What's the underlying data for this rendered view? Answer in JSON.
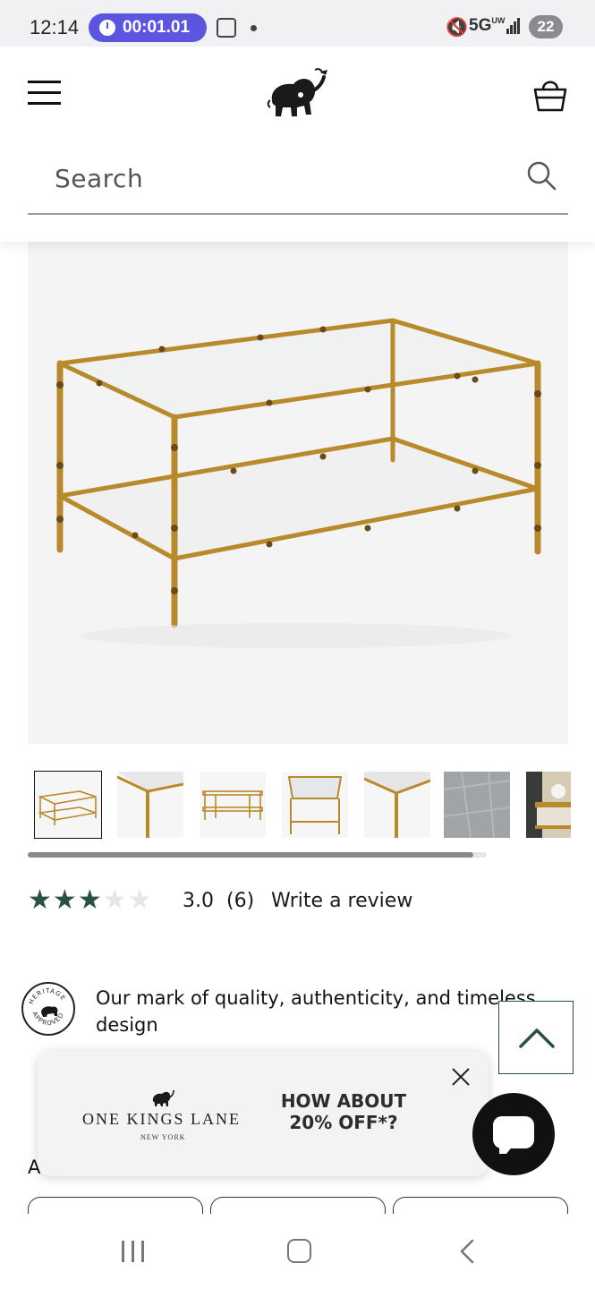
{
  "status_bar": {
    "time": "12:14",
    "timer": "00:01.01",
    "network": "5G",
    "network_sub": "UW",
    "battery": "22"
  },
  "header": {
    "menu_icon": "hamburger-icon",
    "logo_icon": "elephant-logo",
    "cart_icon": "shopping-bag-icon"
  },
  "search": {
    "placeholder": "Search",
    "icon": "search-icon"
  },
  "product": {
    "main_image": "gold bamboo coffee table with glass top",
    "thumbnails": [
      {
        "desc": "coffee table full view",
        "selected": true
      },
      {
        "desc": "table corner detail with glass",
        "selected": false
      },
      {
        "desc": "table side view",
        "selected": false
      },
      {
        "desc": "table top view with mirror glass",
        "selected": false
      },
      {
        "desc": "glass and leg detail",
        "selected": false
      },
      {
        "desc": "grey textured swatch",
        "selected": false
      },
      {
        "desc": "styled room scene",
        "selected": false
      }
    ],
    "thumb_scroll_progress": 0.97
  },
  "rating": {
    "stars_filled": 3,
    "stars_total": 5,
    "value": "3.0",
    "count": "(6)",
    "write_review": "Write a review"
  },
  "heritage": {
    "badge_top": "HERITAGE",
    "badge_bottom": "APPROVED",
    "text": "Our mark of quality, authenticity, and timeless design"
  },
  "hidden_row_text": "A",
  "promo": {
    "brand": "ONE KINGS LANE",
    "city": "NEW YORK",
    "offer": "HOW ABOUT 20% OFF*?",
    "close_icon": "close-icon"
  },
  "floating": {
    "back_to_top_icon": "chevron-up-icon",
    "chat_icon": "chat-bubble-icon"
  },
  "colors": {
    "accent_green": "#2a5243",
    "timer_bg": "#5b55e0",
    "gold": "#b88a2c"
  },
  "navbar": {
    "recents_icon": "recents-icon",
    "home_icon": "home-icon",
    "back_icon": "back-icon"
  }
}
